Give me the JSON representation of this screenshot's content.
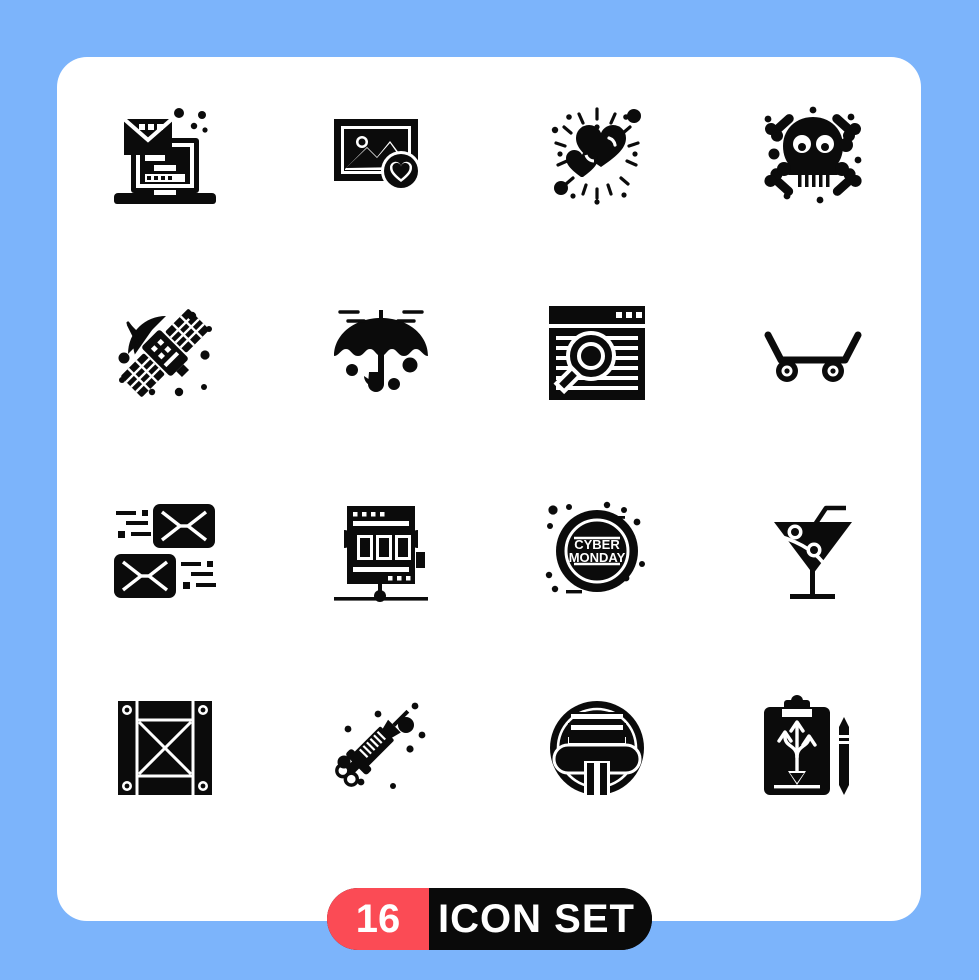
{
  "canvas": {
    "background_color": "#7cb4fb",
    "card_color": "#ffffff"
  },
  "badge": {
    "count": "16",
    "label": "ICON SET",
    "count_bg_color": "#fb4b55",
    "label_bg_color": "#0a0a0a",
    "text_color": "#ffffff"
  },
  "icons": {
    "color": "#0b0b0b",
    "items": [
      {
        "index": 1,
        "name": "laptop-email-icon",
        "title": "Email Marketing"
      },
      {
        "index": 2,
        "name": "favorite-photo-icon",
        "title": "Favorite Photo"
      },
      {
        "index": 3,
        "name": "shining-hearts-icon",
        "title": "Love"
      },
      {
        "index": 4,
        "name": "skull-crossbones-icon",
        "title": "Skull"
      },
      {
        "index": 5,
        "name": "satellite-icon",
        "title": "Satellite"
      },
      {
        "index": 6,
        "name": "umbrella-rain-icon",
        "title": "Umbrella"
      },
      {
        "index": 7,
        "name": "browser-search-icon",
        "title": "Web Search"
      },
      {
        "index": 8,
        "name": "skateboard-icon",
        "title": "Skateboard"
      },
      {
        "index": 9,
        "name": "mail-transfer-icon",
        "title": "Send Receive Mail"
      },
      {
        "index": 10,
        "name": "server-display-icon",
        "title": "Server"
      },
      {
        "index": 11,
        "name": "cyber-monday-badge-icon",
        "title": "Cyber Monday"
      },
      {
        "index": 12,
        "name": "cocktail-glass-icon",
        "title": "Cocktail"
      },
      {
        "index": 13,
        "name": "wooden-crate-icon",
        "title": "Crate"
      },
      {
        "index": 14,
        "name": "syringe-icon",
        "title": "Injection"
      },
      {
        "index": 15,
        "name": "greek-column-badge-icon",
        "title": "Architecture"
      },
      {
        "index": 16,
        "name": "clipboard-strategy-icon",
        "title": "Strategy"
      }
    ],
    "badge_text": {
      "cyber_monday_line1": "CYBER",
      "cyber_monday_line2": "MONDAY"
    }
  }
}
